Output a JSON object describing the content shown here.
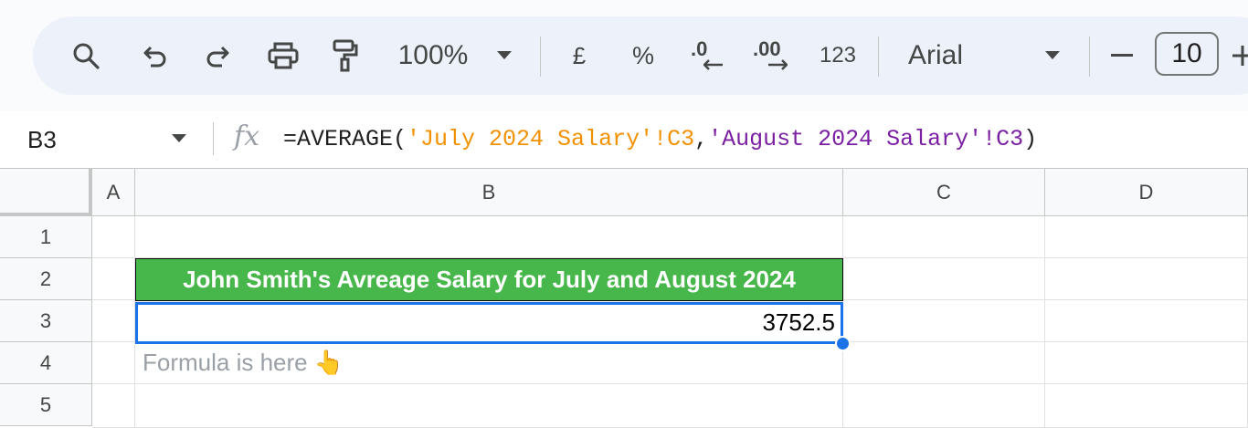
{
  "toolbar": {
    "icons": {
      "search": "search-icon",
      "undo": "undo-icon",
      "redo": "redo-icon",
      "print": "print-icon",
      "paint_format": "paint-format-icon"
    },
    "zoom": "100%",
    "currency": "£",
    "percent": "%",
    "decrease_decimal": ".0",
    "increase_decimal": ".00",
    "number_format": "123",
    "font": "Arial",
    "font_size": "10",
    "decrease_size": "—",
    "increase_size": "+"
  },
  "formula_bar": {
    "name_box": "B3",
    "fx": "fx",
    "formula_prefix": "=AVERAGE(",
    "ref1": "'July 2024 Salary'!C3",
    "comma": ",",
    "ref2": "'August 2024 Salary'!C3",
    "formula_suffix": ")"
  },
  "grid": {
    "columns": [
      "A",
      "B",
      "C",
      "D"
    ],
    "rows": [
      "1",
      "2",
      "3",
      "4",
      "5"
    ],
    "cells": {
      "B2": "John Smith's Avreage Salary for July and August 2024",
      "B3": "3752.5",
      "B4": "Formula is here 👆"
    }
  },
  "colors": {
    "header_fill": "#47b74b",
    "selection": "#1a73e8",
    "ref1_color": "#f29100",
    "ref2_color": "#7b1fa2"
  }
}
